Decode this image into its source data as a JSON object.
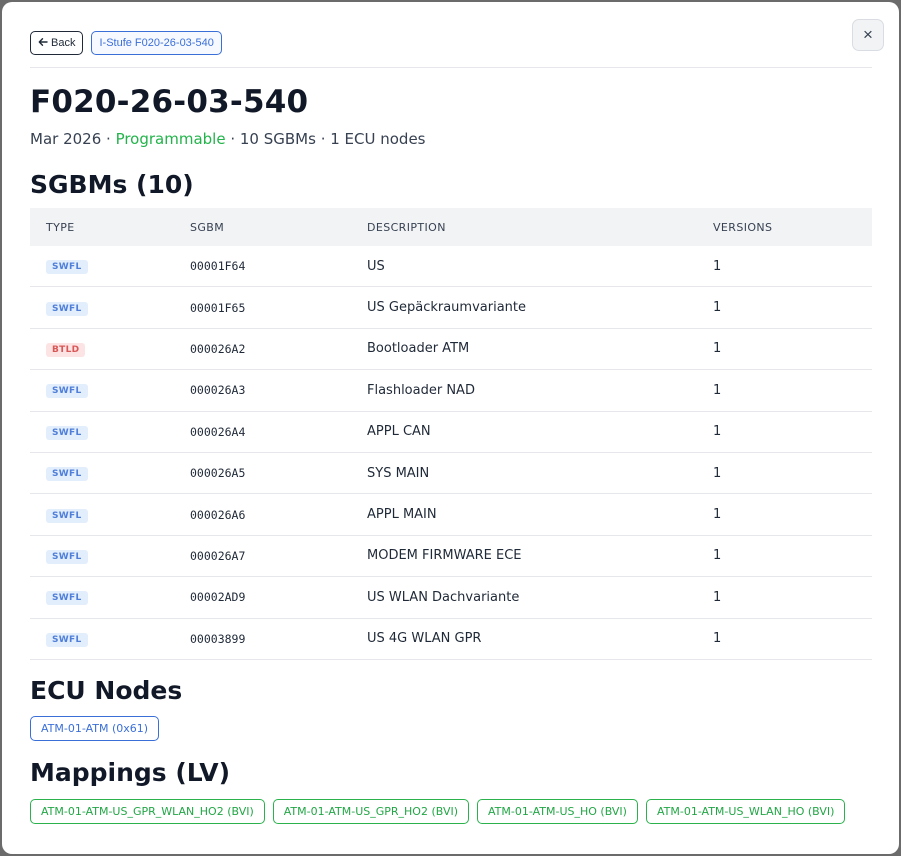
{
  "header": {
    "back_label": "Back",
    "crumb_label": "I-Stufe F020-26-03-540",
    "close_icon": "×"
  },
  "title": "F020-26-03-540",
  "meta": {
    "date": "Mar 2026",
    "sep1": " · ",
    "status": "Programmable",
    "status_color": "#22b44a",
    "rest": " · 10 SGBMs · 1 ECU nodes"
  },
  "sgbms": {
    "heading": "SGBMs (10)",
    "columns": [
      "TYPE",
      "SGBM",
      "DESCRIPTION",
      "VERSIONS"
    ],
    "rows": [
      {
        "type": "SWFL",
        "sgbm": "00001F64",
        "description": "US",
        "versions": "1"
      },
      {
        "type": "SWFL",
        "sgbm": "00001F65",
        "description": "US Gepäckraumvariante",
        "versions": "1"
      },
      {
        "type": "BTLD",
        "sgbm": "000026A2",
        "description": "Bootloader ATM",
        "versions": "1"
      },
      {
        "type": "SWFL",
        "sgbm": "000026A3",
        "description": "Flashloader NAD",
        "versions": "1"
      },
      {
        "type": "SWFL",
        "sgbm": "000026A4",
        "description": "APPL CAN",
        "versions": "1"
      },
      {
        "type": "SWFL",
        "sgbm": "000026A5",
        "description": "SYS MAIN",
        "versions": "1"
      },
      {
        "type": "SWFL",
        "sgbm": "000026A6",
        "description": "APPL MAIN",
        "versions": "1"
      },
      {
        "type": "SWFL",
        "sgbm": "000026A7",
        "description": "MODEM FIRMWARE ECE",
        "versions": "1"
      },
      {
        "type": "SWFL",
        "sgbm": "00002AD9",
        "description": "US WLAN Dachvariante",
        "versions": "1"
      },
      {
        "type": "SWFL",
        "sgbm": "00003899",
        "description": "US 4G WLAN GPR",
        "versions": "1"
      }
    ]
  },
  "ecu": {
    "heading": "ECU Nodes",
    "nodes": [
      "ATM-01-ATM (0x61)"
    ]
  },
  "mappings": {
    "heading": "Mappings (LV)",
    "items": [
      "ATM-01-ATM-US_GPR_WLAN_HO2 (BVI)",
      "ATM-01-ATM-US_GPR_HO2 (BVI)",
      "ATM-01-ATM-US_HO (BVI)",
      "ATM-01-ATM-US_WLAN_HO (BVI)"
    ]
  }
}
